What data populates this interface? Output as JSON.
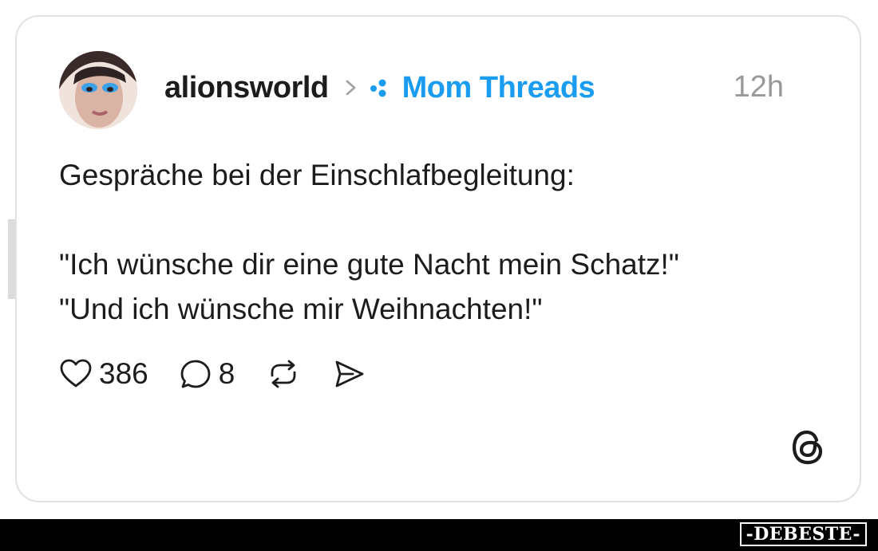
{
  "post": {
    "username": "alionsworld",
    "community": "Mom Threads",
    "timestamp": "12h",
    "lines": [
      "Gespräche bei der Einschlafbegleitung:",
      "\"Ich wünsche dir eine gute Nacht mein Schatz!\"",
      "\"Und ich wünsche mir Weihnachten!\""
    ]
  },
  "actions": {
    "likes": "386",
    "replies": "8"
  },
  "colors": {
    "accent": "#1a9cf0",
    "text": "#1c1c1c",
    "muted": "#999999",
    "border": "#e2e2e2"
  },
  "icons": {
    "like": "heart-icon",
    "reply": "comment-icon",
    "repost": "repost-icon",
    "share": "send-icon",
    "community": "community-dots-icon",
    "separator": "chevron-right-icon",
    "brand": "threads-logo-icon"
  },
  "watermark": {
    "side_text": "DEBESTE",
    "footer_text": "-DEBESTE-"
  }
}
